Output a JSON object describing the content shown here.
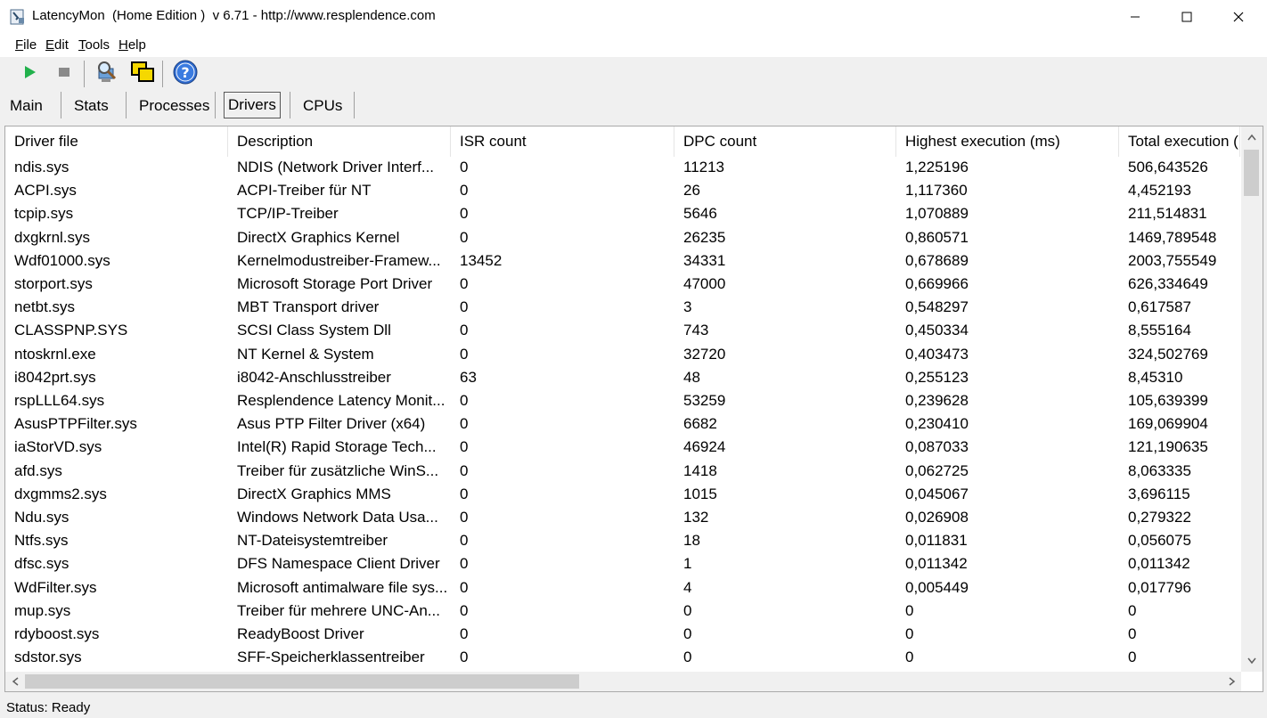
{
  "window": {
    "title": "LatencyMon  (Home Edition )  v 6.71 - http://www.resplendence.com",
    "controls": [
      "minimize",
      "maximize",
      "close"
    ]
  },
  "menu": [
    {
      "label": "File",
      "mnemonic": "F",
      "rest": "ile"
    },
    {
      "label": "Edit",
      "mnemonic": "E",
      "rest": "dit"
    },
    {
      "label": "Tools",
      "mnemonic": "T",
      "rest": "ools"
    },
    {
      "label": "Help",
      "mnemonic": "H",
      "rest": "elp"
    }
  ],
  "toolbar": {
    "icons": [
      "play-icon",
      "stop-icon",
      "magnify-computer-icon",
      "copy-windows-icon",
      "help-icon"
    ],
    "play_color": "#22b14c"
  },
  "tabs": [
    {
      "label": "Main",
      "active": false
    },
    {
      "label": "Stats",
      "active": false
    },
    {
      "label": "Processes",
      "active": false
    },
    {
      "label": "Drivers",
      "active": true
    },
    {
      "label": "CPUs",
      "active": false
    }
  ],
  "table": {
    "columns": [
      "Driver file",
      "Description",
      "ISR count",
      "DPC count",
      "Highest execution (ms)",
      "Total execution ("
    ],
    "rows": [
      [
        "ndis.sys",
        "NDIS (Network Driver Interf...",
        "0",
        "11213",
        "1,225196",
        "506,643526"
      ],
      [
        "ACPI.sys",
        "ACPI-Treiber für NT",
        "0",
        "26",
        "1,117360",
        "4,452193"
      ],
      [
        "tcpip.sys",
        "TCP/IP-Treiber",
        "0",
        "5646",
        "1,070889",
        "211,514831"
      ],
      [
        "dxgkrnl.sys",
        "DirectX Graphics Kernel",
        "0",
        "26235",
        "0,860571",
        "1469,789548"
      ],
      [
        "Wdf01000.sys",
        "Kernelmodustreiber-Framew...",
        "13452",
        "34331",
        "0,678689",
        "2003,755549"
      ],
      [
        "storport.sys",
        "Microsoft Storage Port Driver",
        "0",
        "47000",
        "0,669966",
        "626,334649"
      ],
      [
        "netbt.sys",
        "MBT Transport driver",
        "0",
        "3",
        "0,548297",
        "0,617587"
      ],
      [
        "CLASSPNP.SYS",
        "SCSI Class System Dll",
        "0",
        "743",
        "0,450334",
        "8,555164"
      ],
      [
        "ntoskrnl.exe",
        "NT Kernel & System",
        "0",
        "32720",
        "0,403473",
        "324,502769"
      ],
      [
        "i8042prt.sys",
        "i8042-Anschlusstreiber",
        "63",
        "48",
        "0,255123",
        "8,45310"
      ],
      [
        "rspLLL64.sys",
        "Resplendence Latency Monit...",
        "0",
        "53259",
        "0,239628",
        "105,639399"
      ],
      [
        "AsusPTPFilter.sys",
        "Asus PTP Filter Driver (x64)",
        "0",
        "6682",
        "0,230410",
        "169,069904"
      ],
      [
        "iaStorVD.sys",
        "Intel(R) Rapid Storage Tech...",
        "0",
        "46924",
        "0,087033",
        "121,190635"
      ],
      [
        "afd.sys",
        "Treiber für zusätzliche WinS...",
        "0",
        "1418",
        "0,062725",
        "8,063335"
      ],
      [
        "dxgmms2.sys",
        "DirectX Graphics MMS",
        "0",
        "1015",
        "0,045067",
        "3,696115"
      ],
      [
        "Ndu.sys",
        "Windows Network Data Usa...",
        "0",
        "132",
        "0,026908",
        "0,279322"
      ],
      [
        "Ntfs.sys",
        "NT-Dateisystemtreiber",
        "0",
        "18",
        "0,011831",
        "0,056075"
      ],
      [
        "dfsc.sys",
        "DFS Namespace Client Driver",
        "0",
        "1",
        "0,011342",
        "0,011342"
      ],
      [
        "WdFilter.sys",
        "Microsoft antimalware file sys...",
        "0",
        "4",
        "0,005449",
        "0,017796"
      ],
      [
        "mup.sys",
        "Treiber für mehrere UNC-An...",
        "0",
        "0",
        "0",
        "0"
      ],
      [
        "rdyboost.sys",
        "ReadyBoost Driver",
        "0",
        "0",
        "0",
        "0"
      ],
      [
        "sdstor.sys",
        "SFF-Speicherklassentreiber",
        "0",
        "0",
        "0",
        "0"
      ]
    ]
  },
  "status": {
    "text": "Status: Ready"
  }
}
